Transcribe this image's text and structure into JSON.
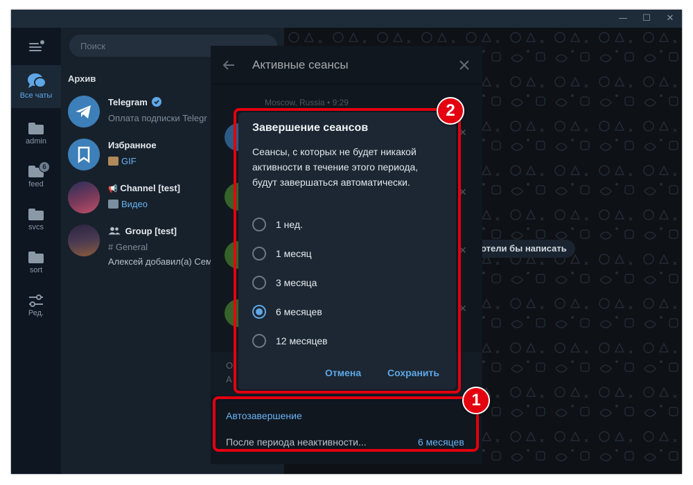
{
  "sidebar": {
    "folders": [
      {
        "label": "Все чаты",
        "icon": "chat-bubbles-icon"
      },
      {
        "label": "admin",
        "icon": "folder-icon"
      },
      {
        "label": "feed",
        "icon": "folder-icon",
        "badge": "6"
      },
      {
        "label": "svcs",
        "icon": "folder-icon"
      },
      {
        "label": "sort",
        "icon": "folder-icon"
      },
      {
        "label": "Ред.",
        "icon": "sliders-icon"
      }
    ]
  },
  "chatlist": {
    "search_placeholder": "Поиск",
    "section_title": "Архив",
    "chats": [
      {
        "name": "Telegram",
        "subtitle": "Оплата подписки Telegr"
      },
      {
        "name": "Избранное",
        "subtitle": "GIF"
      },
      {
        "name": "Channel [test]",
        "subtitle": "Видео"
      },
      {
        "name": "Group [test]",
        "subtitle": "# General",
        "subtitle2": "Алексей добавил(а) Сем"
      }
    ]
  },
  "chat": {
    "hint": "отели бы написать"
  },
  "sessions_panel": {
    "title": "Активные сеансы",
    "visible_session_location": "Moscow, Russia • 9:29",
    "bottom_line1": "О",
    "bottom_line2": "А",
    "auto_title": "Автозавершение",
    "auto_label": "После периода неактивности...",
    "auto_value": "6 месяцев"
  },
  "dialog": {
    "title": "Завершение сеансов",
    "text": "Сеансы, с которых не будет никакой активности в течение этого периода, будут завершаться автоматически.",
    "options": [
      {
        "label": "1 нед.",
        "selected": false
      },
      {
        "label": "1 месяц",
        "selected": false
      },
      {
        "label": "3 месяца",
        "selected": false
      },
      {
        "label": "6 месяцев",
        "selected": true
      },
      {
        "label": "12 месяцев",
        "selected": false
      }
    ],
    "cancel_label": "Отмена",
    "save_label": "Сохранить"
  },
  "annotations": {
    "marker1": "1",
    "marker2": "2",
    "highlight_color": "#e3000f"
  },
  "colors": {
    "accent": "#5fa7e6",
    "link": "#6ab3f3",
    "panel_bg": "#17212b",
    "sidebar_bg": "#0e1621"
  }
}
